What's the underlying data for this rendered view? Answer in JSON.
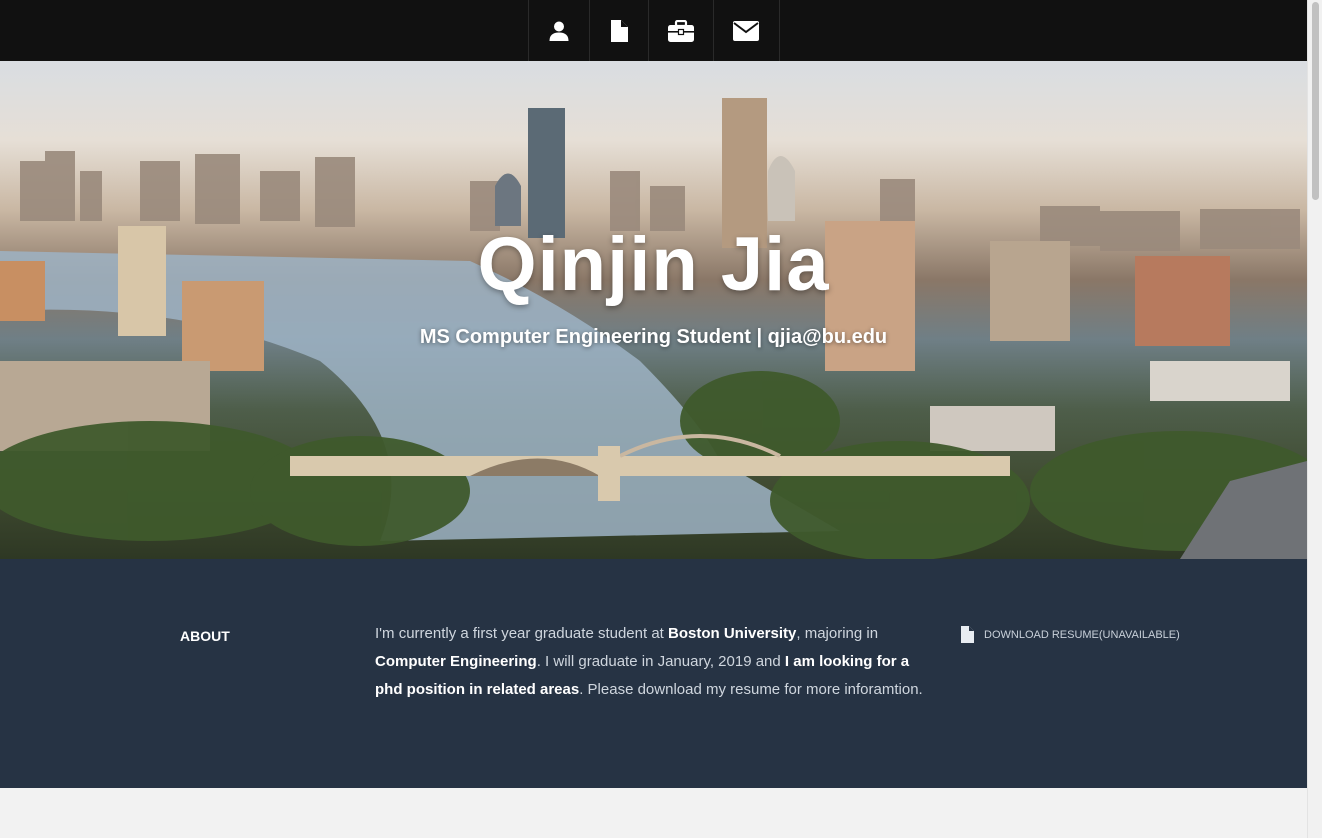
{
  "nav": {
    "items": [
      {
        "icon": "user-icon"
      },
      {
        "icon": "file-icon"
      },
      {
        "icon": "briefcase-icon"
      },
      {
        "icon": "envelope-icon"
      }
    ]
  },
  "hero": {
    "name": "Qinjin Jia",
    "subtitle": "MS Computer Engineering Student | qjia@bu.edu"
  },
  "about": {
    "heading": "ABOUT",
    "text": {
      "p1": "I'm currently a first year graduate student at ",
      "b1": "Boston University",
      "p2": ", majoring in ",
      "b2": "Computer Engineering",
      "p3": ". I will graduate in January, 2019 and ",
      "b3": "I am looking for a phd position in related areas",
      "p4": ". Please download my resume for more inforamtion."
    },
    "resume_label": "DOWNLOAD RESUME(UNAVAILABLE)"
  },
  "colors": {
    "nav_bg": "#111111",
    "about_bg": "#263344",
    "accent_text": "#ffffff"
  }
}
